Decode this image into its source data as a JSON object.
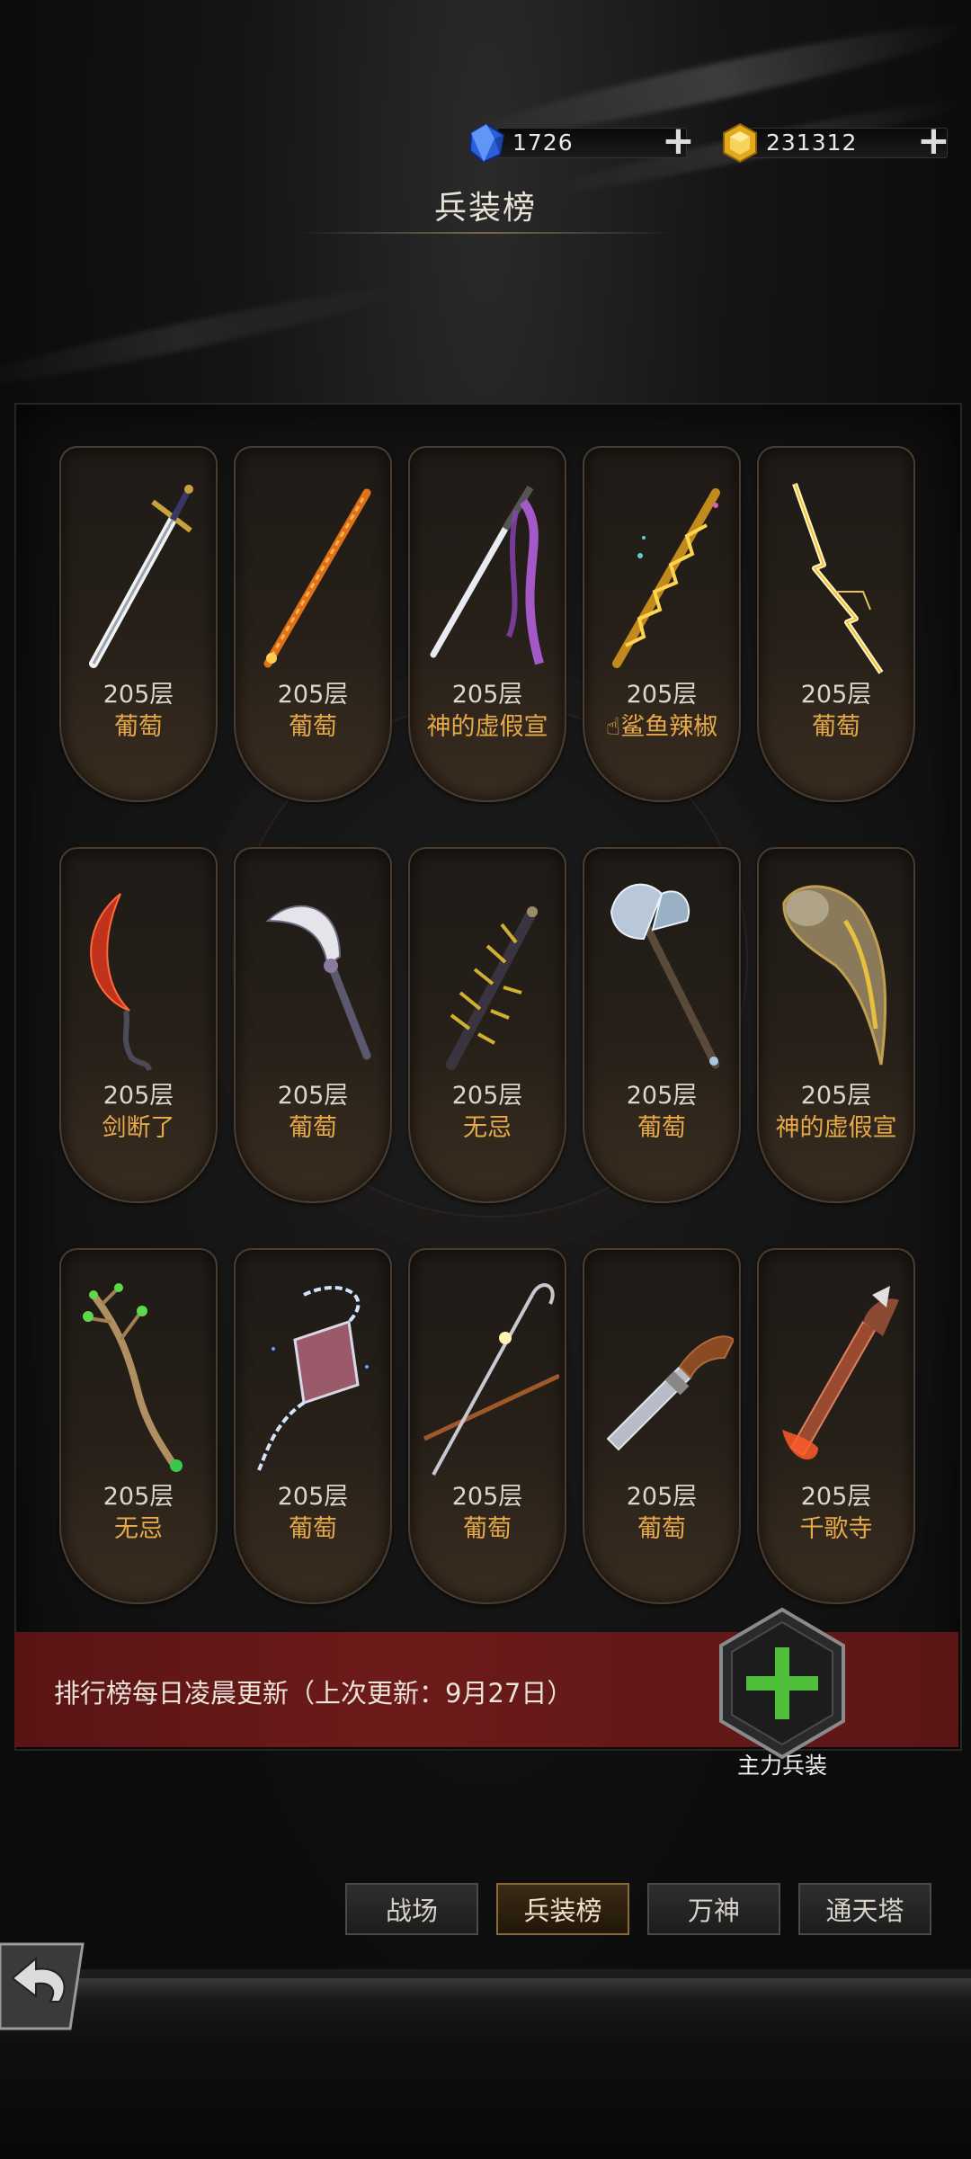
{
  "resources": {
    "diamond": {
      "value": "1726",
      "icon": "blue-crystal-icon"
    },
    "gold": {
      "value": "231312",
      "icon": "gold-crystal-icon"
    },
    "plus": "+"
  },
  "title": "兵装榜",
  "weapons": [
    {
      "level": "205层",
      "name": "葡萄",
      "icon": "silver-sword-icon"
    },
    {
      "level": "205层",
      "name": "葡萄",
      "icon": "flame-sword-icon"
    },
    {
      "level": "205层",
      "name": "神的虚假宣",
      "icon": "katana-ribbon-icon"
    },
    {
      "level": "205层",
      "name": "☝鲨鱼辣椒",
      "icon": "golden-spear-icon"
    },
    {
      "level": "205层",
      "name": "葡萄",
      "icon": "lightning-blade-icon"
    },
    {
      "level": "205层",
      "name": "剑断了",
      "icon": "crimson-sickle-icon"
    },
    {
      "level": "205层",
      "name": "葡萄",
      "icon": "serrated-dagger-icon"
    },
    {
      "level": "205层",
      "name": "无忌",
      "icon": "spiked-blade-icon"
    },
    {
      "level": "205层",
      "name": "葡萄",
      "icon": "battle-axe-icon"
    },
    {
      "level": "205层",
      "name": "神的虚假宣",
      "icon": "horn-relic-icon"
    },
    {
      "level": "205层",
      "name": "无忌",
      "icon": "leaf-staff-icon"
    },
    {
      "level": "205层",
      "name": "葡萄",
      "icon": "chain-gauntlet-icon"
    },
    {
      "level": "205层",
      "name": "葡萄",
      "icon": "crossed-staves-icon"
    },
    {
      "level": "205层",
      "name": "葡萄",
      "icon": "flintlock-pistol-icon"
    },
    {
      "level": "205层",
      "name": "千歌寺",
      "icon": "fire-gun-icon"
    }
  ],
  "update_notice": "排行榜每日凌晨更新（上次更新：9月27日）",
  "main_weapon_label": "主力兵装",
  "tabs": [
    {
      "label": "战场",
      "active": false
    },
    {
      "label": "兵装榜",
      "active": true
    },
    {
      "label": "万神",
      "active": false
    },
    {
      "label": "通天塔",
      "active": false
    }
  ],
  "colors": {
    "accent_gold": "#e7a94a",
    "banner_red": "#6d1a1a",
    "plus_green": "#4fbf3a"
  }
}
